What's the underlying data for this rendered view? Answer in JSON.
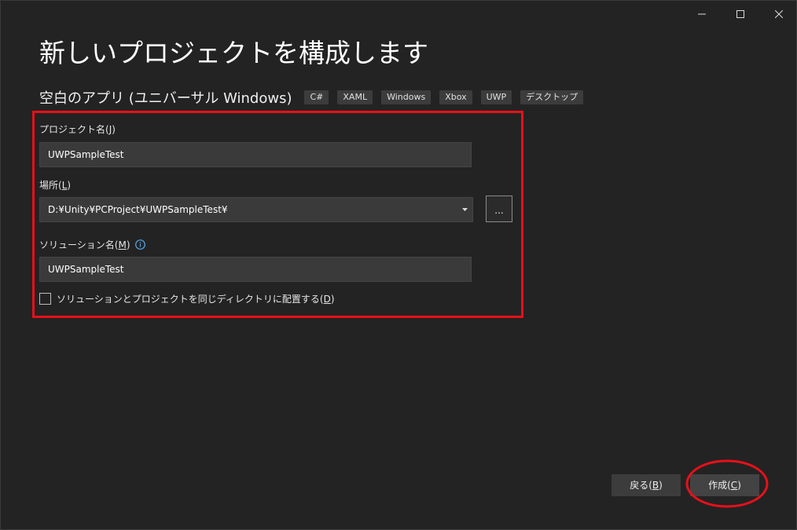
{
  "window": {
    "controls": {
      "minimize_icon": "minimize-icon",
      "maximize_icon": "maximize-icon",
      "close_icon": "close-icon"
    }
  },
  "header": {
    "title": "新しいプロジェクトを構成します",
    "template_name": "空白のアプリ (ユニバーサル Windows)",
    "tags": [
      "C#",
      "XAML",
      "Windows",
      "Xbox",
      "UWP",
      "デスクトップ"
    ]
  },
  "form": {
    "project_name": {
      "label": "プロジェクト名(",
      "accel": "J",
      "label_end": ")",
      "value": "UWPSampleTest"
    },
    "location": {
      "label": "場所(",
      "accel": "L",
      "label_end": ")",
      "value": "D:¥Unity¥PCProject¥UWPSampleTest¥",
      "browse_label": "..."
    },
    "solution_name": {
      "label": "ソリューション名(",
      "accel": "M",
      "label_end": ")",
      "value": "UWPSampleTest"
    },
    "same_directory": {
      "label": "ソリューションとプロジェクトを同じディレクトリに配置する(",
      "accel": "D",
      "label_end": ")",
      "checked": false
    }
  },
  "footer": {
    "back_label": "戻る(",
    "back_accel": "B",
    "back_end": ")",
    "create_label": "作成(",
    "create_accel": "C",
    "create_end": ")"
  },
  "annotations": {
    "highlight_color": "#e8101a"
  }
}
